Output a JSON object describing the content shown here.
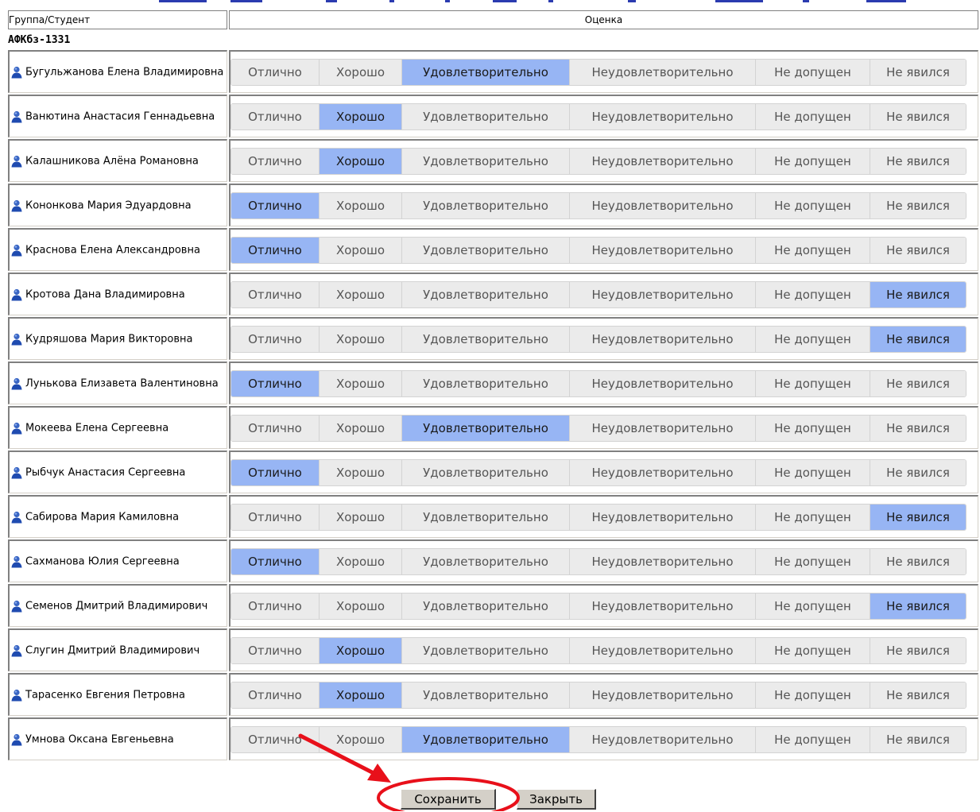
{
  "header": {
    "col_student": "Группа/Студент",
    "col_grade": "Оценка"
  },
  "group": "АФКбз-1331",
  "options": [
    "Отлично",
    "Хорошо",
    "Удовлетворительно",
    "Неудовлетворительно",
    "Не допущен",
    "Не явился"
  ],
  "students": [
    {
      "name": "Бугульжанова Елена Владимировна",
      "grade": 2
    },
    {
      "name": "Ванютина Анастасия Геннадьевна",
      "grade": 1
    },
    {
      "name": "Калашникова Алёна Романовна",
      "grade": 1
    },
    {
      "name": "Кононкова Мария Эдуардовна",
      "grade": 0
    },
    {
      "name": "Краснова Елена Александровна",
      "grade": 0
    },
    {
      "name": "Кротова Дана Владимировна",
      "grade": 5
    },
    {
      "name": "Кудряшова Мария Викторовна",
      "grade": 5
    },
    {
      "name": "Лунькова Елизавета Валентиновна",
      "grade": 0
    },
    {
      "name": "Мокеева Елена Сергеевна",
      "grade": 2
    },
    {
      "name": "Рыбчук Анастасия Сергеевна",
      "grade": 0
    },
    {
      "name": "Сабирова Мария Камиловна",
      "grade": 5
    },
    {
      "name": "Сахманова Юлия Сергеевна",
      "grade": 0
    },
    {
      "name": "Семенов Дмитрий Владимирович",
      "grade": 5
    },
    {
      "name": "Слугин Дмитрий Владимирович",
      "grade": 1
    },
    {
      "name": "Тарасенко Евгения Петровна",
      "grade": 1
    },
    {
      "name": "Умнова Оксана Евгеньевна",
      "grade": 2
    }
  ],
  "buttons": {
    "save": "Сохранить",
    "close": "Закрыть"
  },
  "colors": {
    "selected": "#97b5f4",
    "unselected": "#ebebeb",
    "annotation": "#e8101a"
  }
}
